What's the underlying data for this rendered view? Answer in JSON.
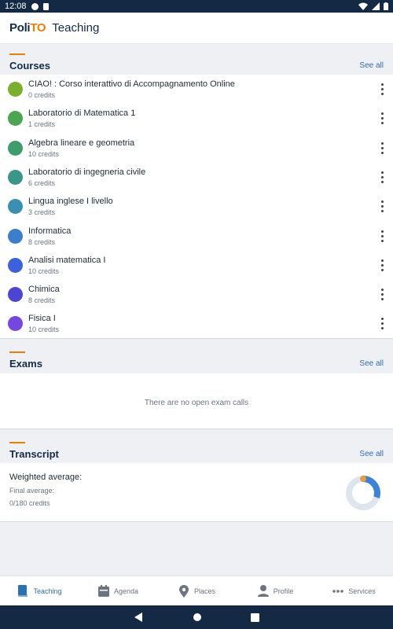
{
  "status_bar": {
    "time": "12:08"
  },
  "header": {
    "logo_prefix": "Poli",
    "logo_suffix": "TO",
    "title": "Teaching"
  },
  "courses": {
    "title": "Courses",
    "see_all": "See all",
    "items": [
      {
        "name": "CIAO! : Corso interattivo di Accompagnamento Online",
        "credits": "0 credits",
        "color": "#7ab02c"
      },
      {
        "name": "Laboratorio di Matematica 1",
        "credits": "1 credits",
        "color": "#4aa74f"
      },
      {
        "name": "Algebra lineare e geometria",
        "credits": "10 credits",
        "color": "#3f9d6b"
      },
      {
        "name": "Laboratorio di ingegneria civile",
        "credits": "6 credits",
        "color": "#3b968a"
      },
      {
        "name": "Lingua inglese I livello",
        "credits": "3 credits",
        "color": "#3a90b3"
      },
      {
        "name": "Informatica",
        "credits": "8 credits",
        "color": "#3b7fcc"
      },
      {
        "name": "Analisi matematica I",
        "credits": "10 credits",
        "color": "#3b62dc"
      },
      {
        "name": "Chimica",
        "credits": "8 credits",
        "color": "#4a45d6"
      },
      {
        "name": "Fisica I",
        "credits": "10 credits",
        "color": "#7646e0"
      }
    ]
  },
  "exams": {
    "title": "Exams",
    "see_all": "See all",
    "empty": "There are no open exam calls"
  },
  "transcript": {
    "title": "Transcript",
    "see_all": "See all",
    "weighted_average": "Weighted average:",
    "final_average": "Final average:",
    "credits": "0/180 credits",
    "donut_fraction": 0.3
  },
  "bottom_nav": [
    {
      "label": "Teaching",
      "icon": "book-icon",
      "active": true
    },
    {
      "label": "Agenda",
      "icon": "calendar-icon",
      "active": false
    },
    {
      "label": "Places",
      "icon": "map-pin-icon",
      "active": false
    },
    {
      "label": "Profile",
      "icon": "person-icon",
      "active": false
    },
    {
      "label": "Services",
      "icon": "more-dots-icon",
      "active": false
    }
  ],
  "colors": {
    "accent": "#ef7d00",
    "brand": "#132a49",
    "link": "#2b6fb5",
    "system_bar": "#142a44"
  }
}
